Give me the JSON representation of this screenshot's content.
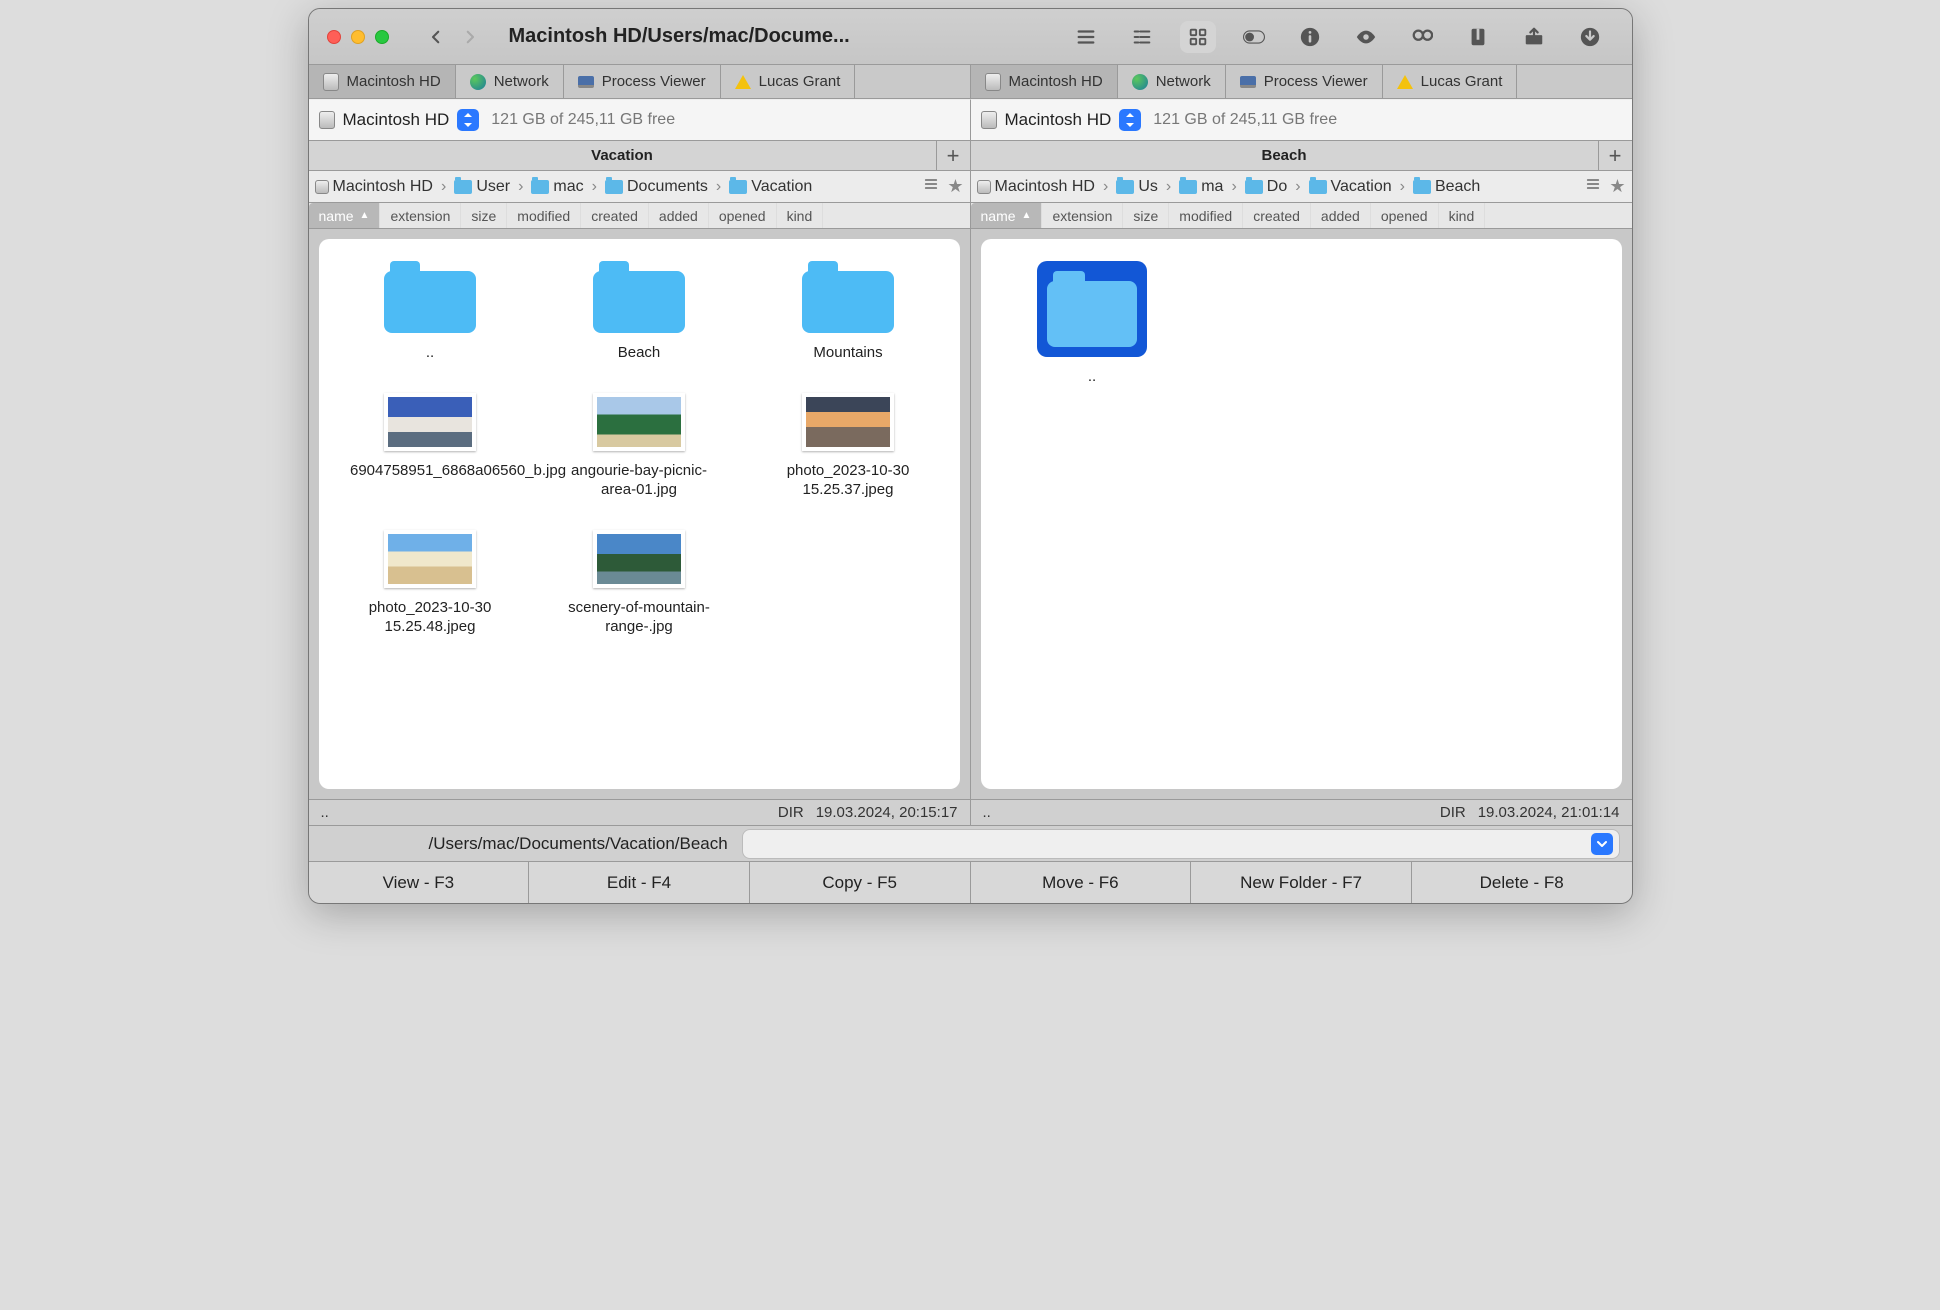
{
  "title": "Macintosh HD/Users/mac/Docume...",
  "shelf_tabs": [
    {
      "label": "Macintosh HD",
      "icon": "hd"
    },
    {
      "label": "Network",
      "icon": "globe"
    },
    {
      "label": "Process Viewer",
      "icon": "laptop"
    },
    {
      "label": "Lucas Grant",
      "icon": "gd"
    }
  ],
  "left": {
    "volume": "Macintosh HD",
    "free": "121 GB of 245,11 GB free",
    "tab": "Vacation",
    "crumbs": [
      "Macintosh HD",
      "User",
      "mac",
      "Documents",
      "Vacation"
    ],
    "columns": [
      "name",
      "extension",
      "size",
      "modified",
      "created",
      "added",
      "opened",
      "kind"
    ],
    "items": [
      {
        "name": "..",
        "type": "folder"
      },
      {
        "name": "Beach",
        "type": "folder"
      },
      {
        "name": "Mountains",
        "type": "folder"
      },
      {
        "name": "6904758951_6868a06560_b.jpg",
        "type": "image",
        "th": "t-mtn"
      },
      {
        "name": "angourie-bay-picnic-area-01.jpg",
        "type": "image",
        "th": "t-bay"
      },
      {
        "name": "photo_2023-10-30 15.25.37.jpeg",
        "type": "image",
        "th": "t-sunset"
      },
      {
        "name": "photo_2023-10-30 15.25.48.jpeg",
        "type": "image",
        "th": "t-beach"
      },
      {
        "name": "scenery-of-mountain-range-.jpg",
        "type": "image",
        "th": "t-range"
      }
    ],
    "status": {
      "dots": "..",
      "dir": "DIR",
      "ts": "19.03.2024, 20:15:17"
    }
  },
  "right": {
    "volume": "Macintosh HD",
    "free": "121 GB of 245,11 GB free",
    "tab": "Beach",
    "crumbs": [
      "Macintosh HD",
      "Us",
      "ma",
      "Do",
      "Vacation",
      "Beach"
    ],
    "columns": [
      "name",
      "extension",
      "size",
      "modified",
      "created",
      "added",
      "opened",
      "kind"
    ],
    "items": [
      {
        "name": "..",
        "type": "folder",
        "selected": true
      }
    ],
    "status": {
      "dots": "..",
      "dir": "DIR",
      "ts": "19.03.2024, 21:01:14"
    }
  },
  "pathbar": "/Users/mac/Documents/Vacation/Beach",
  "fn": [
    "View - F3",
    "Edit - F4",
    "Copy - F5",
    "Move - F6",
    "New Folder - F7",
    "Delete - F8"
  ]
}
